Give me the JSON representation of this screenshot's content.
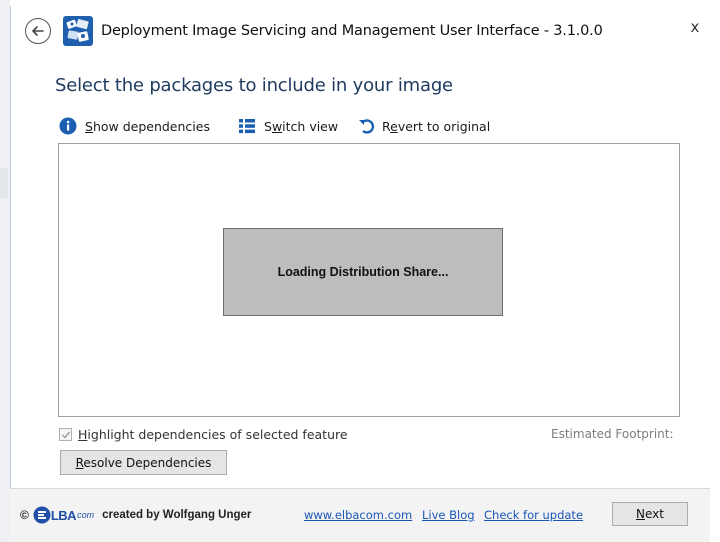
{
  "window": {
    "title": "Deployment Image Servicing and Management User Interface - 3.1.0.0",
    "close_label": "x"
  },
  "heading": "Select the packages to include in your image",
  "toolbar": {
    "show_dependencies": {
      "mnemonic": "S",
      "rest": "how dependencies",
      "icon": "info-icon"
    },
    "switch_view": {
      "pre": "S",
      "mnemonic": "w",
      "rest": "itch view",
      "icon": "list-icon"
    },
    "revert": {
      "pre": "R",
      "mnemonic": "e",
      "rest": "vert to original",
      "icon": "undo-icon"
    }
  },
  "panel": {
    "loading_text": "Loading Distribution Share..."
  },
  "highlight": {
    "checked": true,
    "mnemonic": "H",
    "rest": "ighlight dependencies of selected feature"
  },
  "footprint_label": "Estimated Footprint:",
  "buttons": {
    "resolve": {
      "mnemonic": "R",
      "rest": "esolve Dependencies"
    },
    "next": {
      "mnemonic": "N",
      "rest": "ext"
    }
  },
  "footer": {
    "copyright": "©",
    "logo_main": "LBA",
    "logo_suffix": "com",
    "created_by": "created by Wolfgang Unger",
    "links": {
      "website": "www.elbacom.com",
      "blog": "Live Blog",
      "update": "Check for update"
    }
  },
  "colors": {
    "accent_link": "#1a56b8",
    "heading": "#1e3a5f",
    "loading_box": "#bdbdbd",
    "info_icon": "#1b5fb3"
  }
}
